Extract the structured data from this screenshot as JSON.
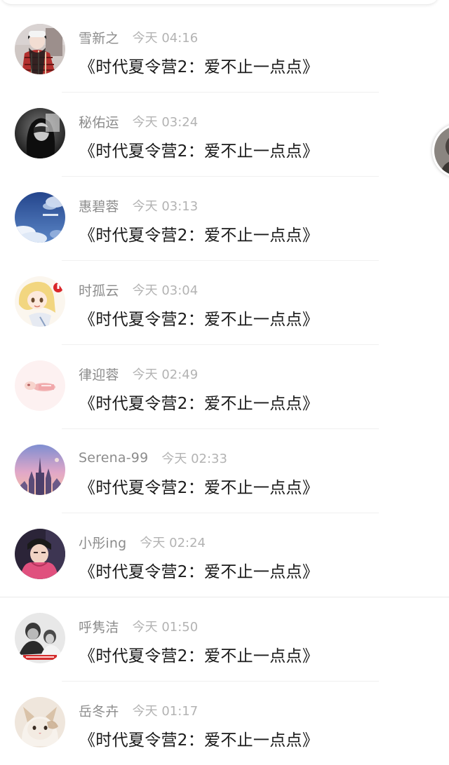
{
  "comments": [
    {
      "username": "雪新之",
      "time": "今天 04:16",
      "text": "《时代夏令营2：爱不止一点点》",
      "avatar": "avatar-girl-plaid-icon"
    },
    {
      "username": "秘佑运",
      "time": "今天 03:24",
      "text": "《时代夏令营2：爱不止一点点》",
      "avatar": "avatar-masked-face-icon"
    },
    {
      "username": "惠碧蓉",
      "time": "今天 03:13",
      "text": "《时代夏令营2：爱不止一点点》",
      "avatar": "avatar-blue-sky-icon"
    },
    {
      "username": "时孤云",
      "time": "今天 03:04",
      "text": "《时代夏令营2：爱不止一点点》",
      "avatar": "avatar-anime-girl-icon"
    },
    {
      "username": "律迎蓉",
      "time": "今天 02:49",
      "text": "《时代夏令营2：爱不止一点点》",
      "avatar": "avatar-pink-cartoon-icon"
    },
    {
      "username": "Serena-99",
      "time": "今天 02:33",
      "text": "《时代夏令营2：爱不止一点点》",
      "avatar": "avatar-castle-sunset-icon"
    },
    {
      "username": "小彤ing",
      "time": "今天 02:24",
      "text": "《时代夏令营2：爱不止一点点》",
      "avatar": "avatar-boy-pink-hoodie-icon"
    },
    {
      "username": "呼隽洁",
      "time": "今天 01:50",
      "text": "《时代夏令营2：爱不止一点点》",
      "avatar": "avatar-people-grayscale-icon"
    },
    {
      "username": "岳冬卉",
      "time": "今天 01:17",
      "text": "《时代夏令营2：爱不止一点点》",
      "avatar": "avatar-kitten-icon"
    }
  ],
  "side_avatar": "floating-avatar-icon",
  "colors": {
    "username": "#8c8c8c",
    "timestamp": "#b3b3b3",
    "comment": "#1a1a1a",
    "divider": "#f0f0f0",
    "background": "#ffffff"
  }
}
